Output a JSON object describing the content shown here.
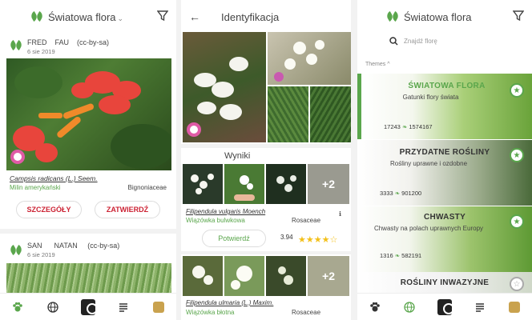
{
  "screen1": {
    "title": "Światowa flora",
    "title_caret": "⌄",
    "card1": {
      "author_first": "FRED",
      "author_last": "FAU",
      "license": "(cc-by-sa)",
      "date": "6 sie 2019",
      "species": "Campsis radicans (L.) Seem.",
      "common_name": "Milin amerykański",
      "family": "Bignoniaceae",
      "details_label": "SZCZEGÓŁY",
      "confirm_label": "ZATWIERDŹ"
    },
    "card2": {
      "author_first": "SAN",
      "author_last": "NATAN",
      "license": "(cc-by-sa)",
      "date": "6 sie 2019"
    }
  },
  "screen2": {
    "title": "Identyfikacja",
    "results_label": "Wyniki",
    "result1": {
      "more_count": "+2",
      "species": "Filipendula vulgaris Moench",
      "common_name": "Wiązówka bulwkowa",
      "family": "Rosaceae",
      "confirm_label": "Potwierdź",
      "score": "3.94",
      "rating": 3.94,
      "info": "ℹ"
    },
    "result2": {
      "more_count": "+2",
      "species": "Filipendula ulmaria (L.) Maxim.",
      "common_name": "Wiązówka błotna",
      "family": "Rosaceae"
    }
  },
  "screen3": {
    "title": "Światowa flora",
    "search_placeholder": "Znajdź florę",
    "themes_label": "Themes",
    "themes_caret": "^",
    "themes": [
      {
        "title": "ŚWIATOWA FLORA",
        "subtitle": "Gatunki flory świata",
        "species": "17243",
        "photos": "1574167"
      },
      {
        "title": "PRZYDATNE ROŚLINY",
        "subtitle": "Rośliny uprawne i ozdobne",
        "species": "3333",
        "photos": "901200"
      },
      {
        "title": "CHWASTY",
        "subtitle": "Chwasty na polach uprawnych Europy",
        "species": "1316",
        "photos": "582191"
      },
      {
        "title": "ROŚLINY INWAZYJNE",
        "subtitle": "",
        "species": "",
        "photos": ""
      }
    ]
  },
  "colors": {
    "accent": "#5aa64c",
    "action_red": "#c8283b",
    "star": "#f3c019"
  }
}
